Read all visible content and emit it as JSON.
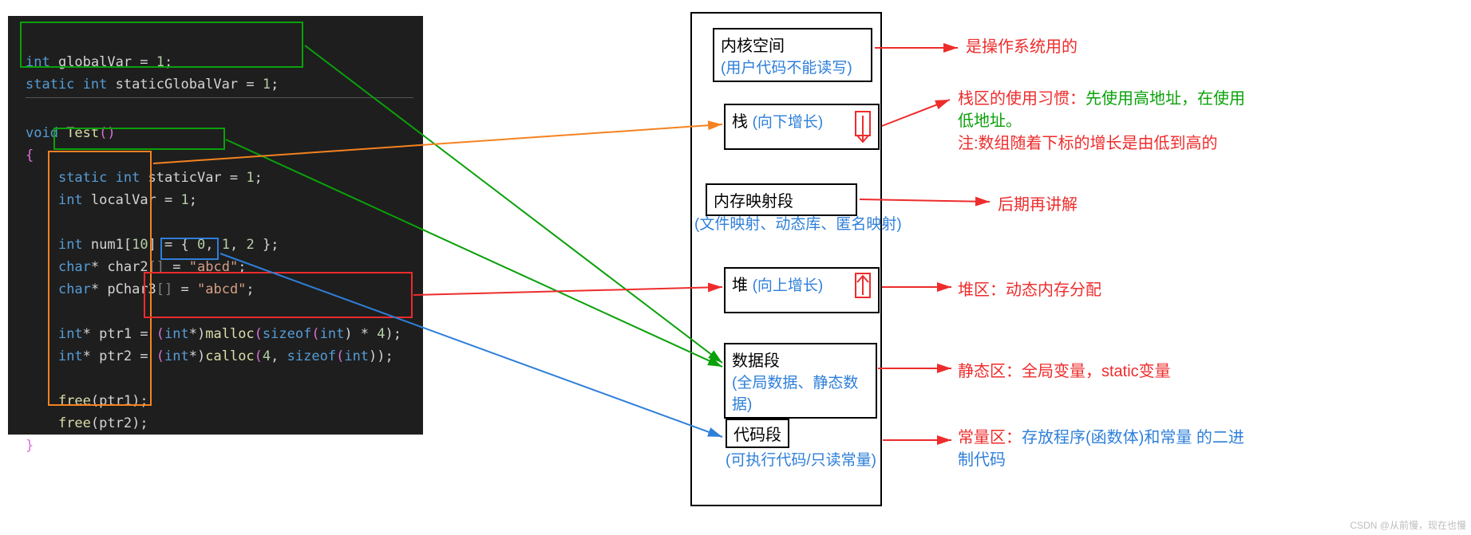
{
  "code": {
    "l1a": "int",
    "l1b": " globalVar = ",
    "l1c": "1",
    "l1d": ";",
    "l2a": "static int",
    "l2b": " staticGlobalVar = ",
    "l2c": "1",
    "l2d": ";",
    "l3a": "void",
    "l3b": " Test",
    "l3c": "()",
    "l4": "{",
    "l5a": "static int",
    "l5b": " staticVar",
    "l5c": " = ",
    "l5d": "1",
    "l5e": ";",
    "l6a": "int",
    "l6b": " localVar",
    "l6c": " = ",
    "l6d": "1",
    "l6e": ";",
    "l7a": "int",
    "l7b": " num1[",
    "l7c": "10",
    "l7d": "] = { ",
    "l7e": "0",
    "l7f": ", ",
    "l7g": "1",
    "l7h": ", ",
    "l7i": "2",
    "l7j": " };",
    "l8a": "char",
    "l8b": "* char2",
    "l8c": "[]",
    "l8d": " = ",
    "l8e": "\"abcd\"",
    "l8f": ";",
    "l9a": "char",
    "l9b": "* pChar3",
    "l9c": "[]",
    "l9d": " = ",
    "l9e": "\"abcd\"",
    "l9f": ";",
    "l10a": "int",
    "l10b": "* ptr1 = ",
    "l10c": "(",
    "l10d": "int",
    "l10e": "*)",
    "l10f": "malloc",
    "l10g": "(",
    "l10h": "sizeof",
    "l10i": "(",
    "l10j": "int",
    "l10k": ") * ",
    "l10l": "4",
    "l10m": ");",
    "l11a": "int",
    "l11b": "* ptr2 = ",
    "l11c": "(",
    "l11d": "int",
    "l11e": "*)",
    "l11f": "calloc",
    "l11g": "(",
    "l11h": "4",
    "l11i": ", ",
    "l11j": "sizeof",
    "l11k": "(",
    "l11l": "int",
    "l11m": "));",
    "l12a": "free",
    "l12b": "(ptr1);",
    "l13a": "free",
    "l13b": "(ptr2);",
    "l14": "}"
  },
  "mem": {
    "kernel_title": "内核空间",
    "kernel_sub": "(用户代码不能读写)",
    "stack_title": "栈",
    "stack_sub": "(向下增长)",
    "mmap_title": "内存映射段",
    "mmap_sub": "(文件映射、动态库、匿名映射)",
    "heap_title": "堆",
    "heap_sub": "(向上增长)",
    "data_title": "数据段",
    "data_sub": "(全局数据、静态数据)",
    "code_title": "代码段",
    "code_sub": "(可执行代码/只读常量)"
  },
  "anno": {
    "kernel": "是操作系统用的",
    "stack_red": "栈区的使用习惯：",
    "stack_green": "先使用高地址，在使用低地址。",
    "stack_note": "注:数组随着下标的增长是由低到高的",
    "mmap": "后期再讲解",
    "heap": "堆区：动态内存分配",
    "data": "静态区：全局变量，static变量",
    "code_label": "常量区：",
    "code_body": "存放程序(函数体)和常量 的二进制代码"
  },
  "watermark": "CSDN @从前慢，现在也慢"
}
